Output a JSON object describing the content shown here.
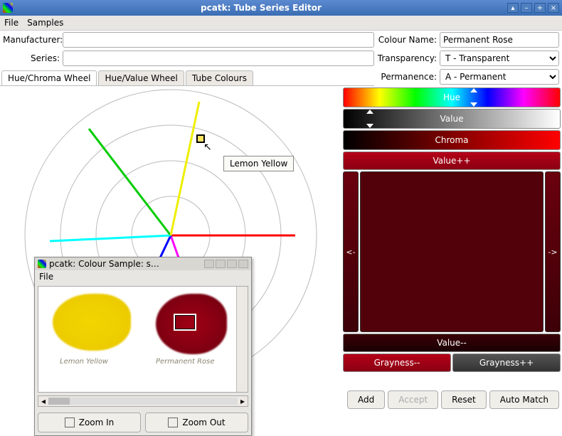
{
  "title": "pcatk: Tube Series Editor",
  "menu": {
    "file": "File",
    "samples": "Samples"
  },
  "fields": {
    "manufacturer_label": "Manufacturer:",
    "manufacturer_value": "",
    "series_label": "Series:",
    "series_value": "",
    "colour_name_label": "Colour Name:",
    "colour_name_value": "Permanent Rose",
    "transparency_label": "Transparency:",
    "transparency_value": "T     - Transparent",
    "permanence_label": "Permanence:",
    "permanence_value": "A     - Permanent"
  },
  "tabs": {
    "hue_chroma": "Hue/Chroma Wheel",
    "hue_value": "Hue/Value Wheel",
    "tube_colours": "Tube Colours"
  },
  "wheel": {
    "tooltip": "Lemon Yellow"
  },
  "sample_window": {
    "title": "pcatk: Colour Sample: s…",
    "menu_file": "File",
    "label_yellow": "Lemon Yellow",
    "label_red": "Permanent Rose",
    "zoom_in": "Zoom In",
    "zoom_out": "Zoom Out"
  },
  "sliders": {
    "hue": "Hue",
    "value": "Value",
    "chroma": "Chroma",
    "value_plus": "Value++",
    "value_minus": "Value--",
    "gray_minus": "Grayness--",
    "gray_plus": "Grayness++",
    "left": "<-",
    "right": "->"
  },
  "buttons": {
    "add": "Add",
    "accept": "Accept",
    "reset": "Reset",
    "auto_match": "Auto Match"
  }
}
